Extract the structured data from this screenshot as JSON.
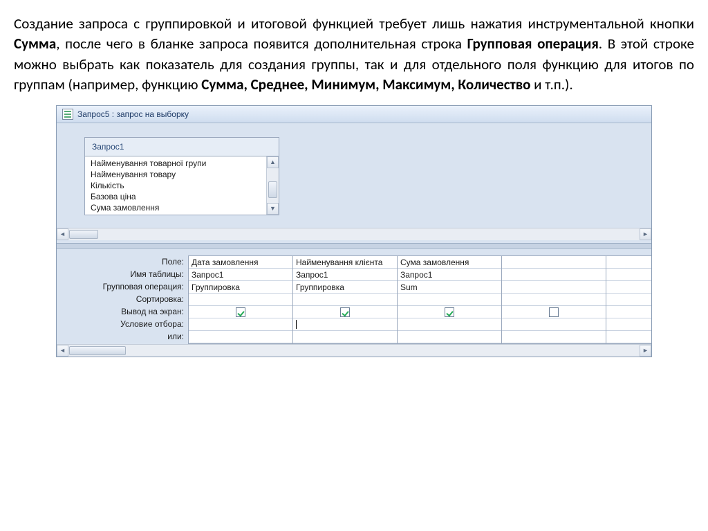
{
  "intro": {
    "s1a": "Создание запроса с группировкой и итоговой функцией требует лишь нажатия инструментальной кнопки ",
    "w1": "Сумма",
    "s1b": ", после чего в бланке запроса появится дополнительная строка ",
    "w2": "Групповая операция",
    "s2": ". В этой строке можно выбрать как показатель для создания группы, так и для отдельного поля функцию для итогов по группам (например, функцию ",
    "w3": "Сумма, Среднее, Минимум, Максимум, Количество",
    "s3": " и т.п.)."
  },
  "window": {
    "title": "Запрос5 : запрос на выборку",
    "table_tab": "Запрос1",
    "fields": [
      "Найменування товарної групи",
      "Найменування товару",
      "Кількість",
      "Базова ціна",
      "Сума замовлення"
    ],
    "row_labels": {
      "field": "Поле:",
      "table": "Имя таблицы:",
      "groupop": "Групповая операция:",
      "sort": "Сортировка:",
      "show": "Вывод на экран:",
      "criteria": "Условие отбора:",
      "or": "или:"
    },
    "columns": [
      {
        "field": "Дата замовлення",
        "table": "Запрос1",
        "groupop": "Группировка",
        "sort": "",
        "show": true,
        "criteria_cursor": false
      },
      {
        "field": "Найменування клієнта",
        "table": "Запрос1",
        "groupop": "Группировка",
        "sort": "",
        "show": true,
        "criteria_cursor": true
      },
      {
        "field": "Сума замовлення",
        "table": "Запрос1",
        "groupop": "Sum",
        "sort": "",
        "show": true,
        "criteria_cursor": false
      }
    ]
  }
}
